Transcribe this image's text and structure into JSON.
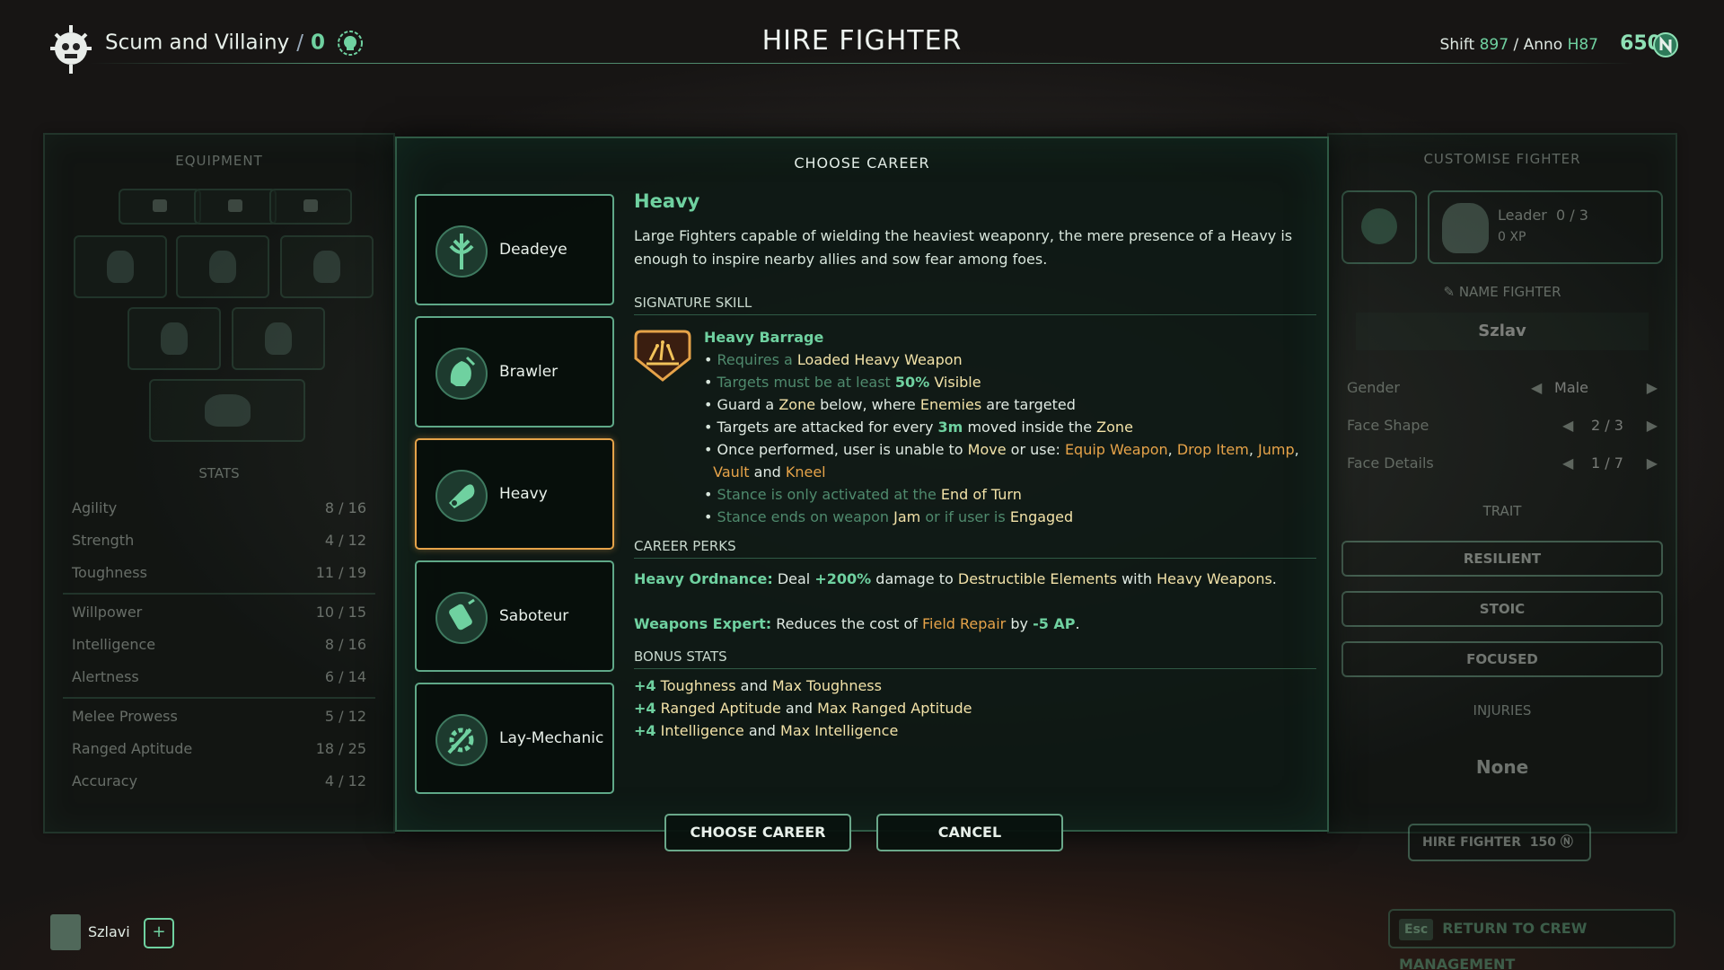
{
  "header": {
    "gang_name": "Scum and Villainy",
    "gang_separator": "/",
    "gang_count": "0",
    "title": "HIRE FIGHTER",
    "shift_label": "Shift",
    "shift_value": "897",
    "anno_label": "/ Anno",
    "anno_value": "H87",
    "credits": "650"
  },
  "equipment": {
    "title": "EQUIPMENT",
    "stats_title": "STATS",
    "stats": [
      {
        "name": "Agility",
        "value": "8 / 16"
      },
      {
        "name": "Strength",
        "value": "4 / 12"
      },
      {
        "name": "Toughness",
        "value": "11 / 19"
      },
      {
        "name": "Willpower",
        "value": "10 / 15"
      },
      {
        "name": "Intelligence",
        "value": "8 / 16"
      },
      {
        "name": "Alertness",
        "value": "6 / 14"
      },
      {
        "name": "Melee Prowess",
        "value": "5 / 12"
      },
      {
        "name": "Ranged Aptitude",
        "value": "18 / 25"
      },
      {
        "name": "Accuracy",
        "value": "4 / 12"
      }
    ]
  },
  "modal": {
    "title": "CHOOSE CAREER",
    "careers": [
      {
        "label": "Deadeye"
      },
      {
        "label": "Brawler"
      },
      {
        "label": "Heavy"
      },
      {
        "label": "Saboteur"
      },
      {
        "label": "Lay-Mechanic"
      }
    ],
    "selected_career": "Heavy",
    "career_name": "Heavy",
    "career_description": "Large Fighters capable of wielding the heaviest weaponry, the mere presence of a Heavy is enough to inspire nearby allies and sow fear among foes.",
    "signature_skill_heading": "SIGNATURE SKILL",
    "skill_name": "Heavy Barrage",
    "skill_lines": {
      "l1a": "Requires a",
      "l1b": "Loaded Heavy Weapon",
      "l2a": "Targets must be at least",
      "l2b": "50%",
      "l2c": "Visible",
      "l3a": "Guard a",
      "l3b": "Zone",
      "l3c": "below, where",
      "l3d": "Enemies",
      "l3e": "are targeted",
      "l4a": "Targets are attacked for every",
      "l4b": "3m",
      "l4c": "moved inside the",
      "l4d": "Zone",
      "l5a": "Once performed, user is unable to",
      "l5b": "Move",
      "l5c": "or use:",
      "l5d": "Equip Weapon",
      "l5e": "Drop Item",
      "l5f": "Jump",
      "l5g": "Vault",
      "l5h": "and",
      "l5i": "Kneel",
      "l6a": "Stance is only activated at the",
      "l6b": "End of Turn",
      "l7a": "Stance ends on weapon",
      "l7b": "Jam",
      "l7c": "or if user is",
      "l7d": "Engaged"
    },
    "perks_heading": "CAREER PERKS",
    "perk1": {
      "name": "Heavy Ordnance:",
      "a": "Deal",
      "b": "+200%",
      "c": "damage to",
      "d": "Destructible Elements",
      "e": "with",
      "f": "Heavy Weapons",
      "g": "."
    },
    "perk2": {
      "name": "Weapons Expert:",
      "a": "Reduces the cost of",
      "b": "Field Repair",
      "c": "by",
      "d": "-5 AP",
      "e": "."
    },
    "bonus_heading": "BONUS STATS",
    "bonus": [
      {
        "amt": "+4",
        "a": "Toughness",
        "and": "and",
        "b": "Max Toughness"
      },
      {
        "amt": "+4",
        "a": "Ranged Aptitude",
        "and": "and",
        "b": "Max Ranged Aptitude"
      },
      {
        "amt": "+4",
        "a": "Intelligence",
        "and": "and",
        "b": "Max Intelligence"
      }
    ],
    "choose_button": "CHOOSE CAREER",
    "cancel_button": "CANCEL"
  },
  "customise": {
    "title": "CUSTOMISE FIGHTER",
    "leader_label": "Leader",
    "leader_value": "0 / 3",
    "xp_value": "0",
    "xp_label": "XP",
    "name_label": "NAME FIGHTER",
    "fighter_name": "Szlav",
    "options": [
      {
        "label": "Gender",
        "value": "Male"
      },
      {
        "label": "Face Shape",
        "value": "2 / 3"
      },
      {
        "label": "Face Details",
        "value": "1 / 7"
      }
    ],
    "trait_title": "TRAIT",
    "traits": [
      "RESILIENT",
      "STOIC",
      "FOCUSED"
    ],
    "injuries_title": "INJURIES",
    "injuries_value": "None",
    "hire_button": "HIRE FIGHTER",
    "hire_cost": "150",
    "return_key": "Esc",
    "return_button": "RETURN TO CREW MANAGEMENT"
  },
  "crew": {
    "name": "Szlavi",
    "add_label": "+"
  },
  "colors": {
    "accent_green": "#6fd1a0",
    "highlight_yellow": "#f2e2a8",
    "highlight_orange": "#e6a349",
    "panel_border": "#2f5a45"
  }
}
